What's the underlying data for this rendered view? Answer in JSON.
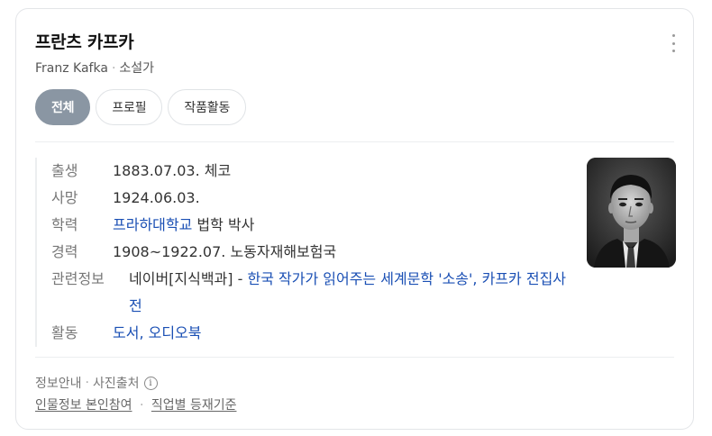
{
  "header": {
    "title": "프란츠 카프카",
    "name_en": "Franz Kafka",
    "separator": "·",
    "occupation": "소설가"
  },
  "tabs": [
    {
      "label": "전체",
      "active": true
    },
    {
      "label": "프로필",
      "active": false
    },
    {
      "label": "작품활동",
      "active": false
    }
  ],
  "info": {
    "birth": {
      "label": "출생",
      "value": "1883.07.03. 체코"
    },
    "death": {
      "label": "사망",
      "value": "1924.06.03."
    },
    "education": {
      "label": "학력",
      "link": "프라하대학교",
      "value": " 법학 박사"
    },
    "career": {
      "label": "경력",
      "value": "1908~1922.07. 노동자재해보험국"
    },
    "related": {
      "label": "관련정보",
      "source": "네이버[지식백과]",
      "dash": " - ",
      "link": "한국 작가가 읽어주는 세계문학 '소송', 카프카 전집사전"
    },
    "activity": {
      "label": "활동",
      "link": "도서, 오디오북"
    }
  },
  "photo": {
    "alt": "Franz Kafka portrait"
  },
  "footer": {
    "info_guide": "정보안내",
    "dot": "·",
    "photo_source": "사진출처",
    "info_icon": "i",
    "profile_link": "인물정보 본인참여",
    "criteria_link": "직업별 등재기준"
  },
  "colors": {
    "accent_link": "#1a4fb4",
    "active_tab": "#8a96a3"
  }
}
